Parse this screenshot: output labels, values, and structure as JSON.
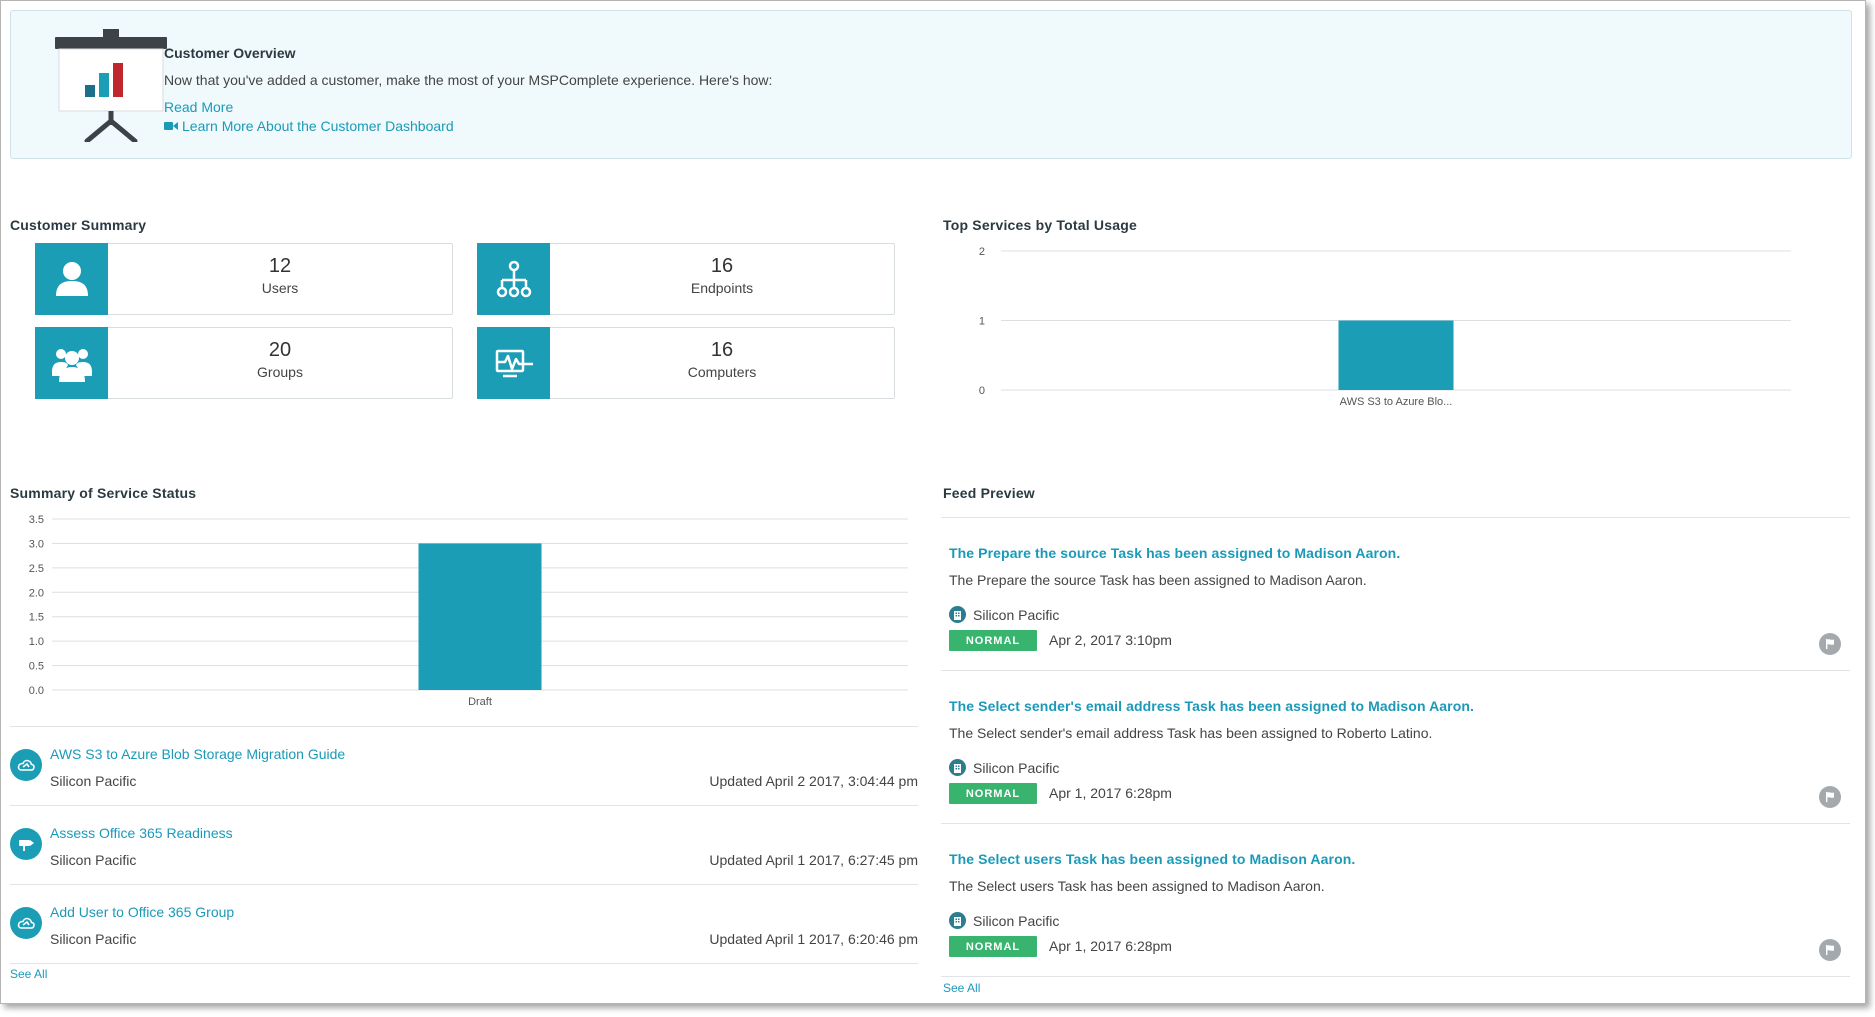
{
  "banner": {
    "title": "Customer Overview",
    "text": "Now that you've added a customer, make the most of your MSPComplete experience. Here's how:",
    "read_more": "Read More",
    "learn_more": "Learn More About the Customer Dashboard"
  },
  "customer_summary": {
    "title": "Customer Summary",
    "cards": [
      {
        "value": "12",
        "label": "Users",
        "icon": "user-icon"
      },
      {
        "value": "16",
        "label": "Endpoints",
        "icon": "network-icon"
      },
      {
        "value": "20",
        "label": "Groups",
        "icon": "group-icon"
      },
      {
        "value": "16",
        "label": "Computers",
        "icon": "computer-activity-icon"
      }
    ]
  },
  "top_services": {
    "title": "Top Services by Total Usage"
  },
  "service_status": {
    "title": "Summary of Service Status",
    "items": [
      {
        "title": "AWS S3 to Azure Blob Storage Migration Guide",
        "org": "Silicon Pacific",
        "updated": "Updated April 2 2017, 3:04:44 pm",
        "icon": "cloud-icon"
      },
      {
        "title": "Assess Office 365 Readiness",
        "org": "Silicon Pacific",
        "updated": "Updated April 1 2017, 6:27:45 pm",
        "icon": "signpost-icon"
      },
      {
        "title": "Add User to Office 365 Group",
        "org": "Silicon Pacific",
        "updated": "Updated April 1 2017, 6:20:46 pm",
        "icon": "cloud-icon"
      }
    ],
    "see_all": "See All"
  },
  "feed": {
    "title": "Feed Preview",
    "items": [
      {
        "title": "The Prepare the source Task has been assigned to Madison Aaron.",
        "desc": "The Prepare the source Task has been assigned to Madison Aaron.",
        "org": "Silicon Pacific",
        "priority": "NORMAL",
        "date": "Apr 2, 2017 3:10pm"
      },
      {
        "title": "The Select sender's email address Task has been assigned to Madison Aaron.",
        "desc": "The Select sender's email address Task has been assigned to Roberto Latino.",
        "org": "Silicon Pacific",
        "priority": "NORMAL",
        "date": "Apr 1, 2017 6:28pm"
      },
      {
        "title": "The Select users Task has been assigned to Madison Aaron.",
        "desc": "The Select users Task has been assigned to Madison Aaron.",
        "org": "Silicon Pacific",
        "priority": "NORMAL",
        "date": "Apr 1, 2017 6:28pm"
      }
    ],
    "see_all": "See All"
  },
  "colors": {
    "accent": "#1b9eb5",
    "link": "#1b9ab8",
    "badge_normal": "#39b46e",
    "banner_bg": "#f0fafc"
  },
  "chart_data": [
    {
      "type": "bar",
      "title": "Top Services by Total Usage",
      "categories": [
        "AWS S3 to Azure Blo..."
      ],
      "values": [
        1
      ],
      "ylim": [
        0,
        2
      ],
      "yticks": [
        0,
        1,
        2
      ],
      "grid": true
    },
    {
      "type": "bar",
      "title": "Summary of Service Status",
      "categories": [
        "Draft"
      ],
      "values": [
        3
      ],
      "ylim": [
        0,
        3.5
      ],
      "yticks": [
        "0.0",
        "0.5",
        "1.0",
        "1.5",
        "2.0",
        "2.5",
        "3.0",
        "3.5"
      ],
      "grid": true
    }
  ]
}
